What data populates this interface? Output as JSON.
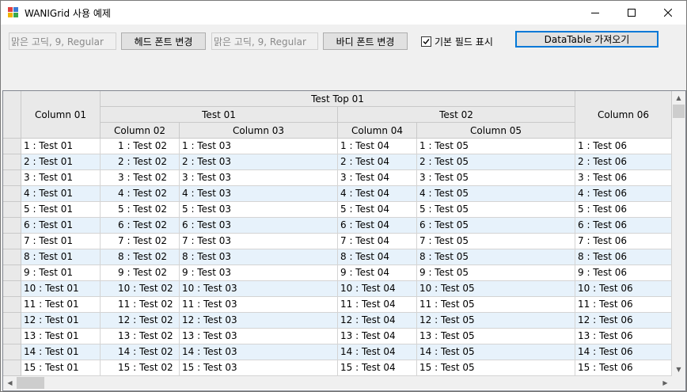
{
  "window": {
    "title": "WANIGrid 사용 예제"
  },
  "toolbar": {
    "head_font_value": "맑은 고딕, 9, Regular",
    "head_font_button": "헤드 폰트 변경",
    "body_font_value": "맑은 고딕, 9, Regular",
    "body_font_button": "바디 폰트 변경",
    "show_default_fields_label": "기본 필드 표시",
    "show_default_fields_checked": true,
    "get_datatable_button": "DataTable 가져오기"
  },
  "grid": {
    "header": {
      "top_group": "Test Top 01",
      "group_1": "Test 01",
      "group_2": "Test 02",
      "column_01": "Column 01",
      "column_02": "Column 02",
      "column_03": "Column 03",
      "column_04": "Column 04",
      "column_05": "Column 05",
      "column_06": "Column 06"
    },
    "rows": [
      [
        "1 : Test 01",
        "1 : Test 02",
        "1 : Test 03",
        "1 : Test 04",
        "1 : Test 05",
        "1 : Test 06"
      ],
      [
        "2 : Test 01",
        "2 : Test 02",
        "2 : Test 03",
        "2 : Test 04",
        "2 : Test 05",
        "2 : Test 06"
      ],
      [
        "3 : Test 01",
        "3 : Test 02",
        "3 : Test 03",
        "3 : Test 04",
        "3 : Test 05",
        "3 : Test 06"
      ],
      [
        "4 : Test 01",
        "4 : Test 02",
        "4 : Test 03",
        "4 : Test 04",
        "4 : Test 05",
        "4 : Test 06"
      ],
      [
        "5 : Test 01",
        "5 : Test 02",
        "5 : Test 03",
        "5 : Test 04",
        "5 : Test 05",
        "5 : Test 06"
      ],
      [
        "6 : Test 01",
        "6 : Test 02",
        "6 : Test 03",
        "6 : Test 04",
        "6 : Test 05",
        "6 : Test 06"
      ],
      [
        "7 : Test 01",
        "7 : Test 02",
        "7 : Test 03",
        "7 : Test 04",
        "7 : Test 05",
        "7 : Test 06"
      ],
      [
        "8 : Test 01",
        "8 : Test 02",
        "8 : Test 03",
        "8 : Test 04",
        "8 : Test 05",
        "8 : Test 06"
      ],
      [
        "9 : Test 01",
        "9 : Test 02",
        "9 : Test 03",
        "9 : Test 04",
        "9 : Test 05",
        "9 : Test 06"
      ],
      [
        "10 : Test 01",
        "10 : Test 02",
        "10 : Test 03",
        "10 : Test 04",
        "10 : Test 05",
        "10 : Test 06"
      ],
      [
        "11 : Test 01",
        "11 : Test 02",
        "11 : Test 03",
        "11 : Test 04",
        "11 : Test 05",
        "11 : Test 06"
      ],
      [
        "12 : Test 01",
        "12 : Test 02",
        "12 : Test 03",
        "12 : Test 04",
        "12 : Test 05",
        "12 : Test 06"
      ],
      [
        "13 : Test 01",
        "13 : Test 02",
        "13 : Test 03",
        "13 : Test 04",
        "13 : Test 05",
        "13 : Test 06"
      ],
      [
        "14 : Test 01",
        "14 : Test 02",
        "14 : Test 03",
        "14 : Test 04",
        "14 : Test 05",
        "14 : Test 06"
      ],
      [
        "15 : Test 01",
        "15 : Test 02",
        "15 : Test 03",
        "15 : Test 04",
        "15 : Test 05",
        "15 : Test 06"
      ]
    ]
  },
  "colors": {
    "alt_row": "#e7f2fb",
    "row": "#ffffff",
    "header_bg": "#e9e9e9",
    "focus_border": "#0078d7"
  }
}
